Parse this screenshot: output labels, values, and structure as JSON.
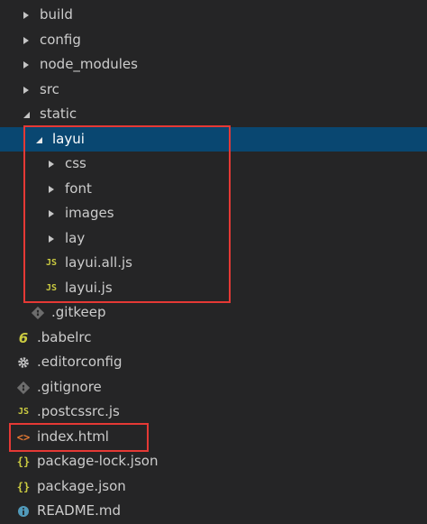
{
  "explorer": {
    "items": [
      {
        "label": "build"
      },
      {
        "label": "config"
      },
      {
        "label": "node_modules"
      },
      {
        "label": "src"
      },
      {
        "label": "static"
      },
      {
        "label": "layui"
      },
      {
        "label": "css"
      },
      {
        "label": "font"
      },
      {
        "label": "images"
      },
      {
        "label": "lay"
      },
      {
        "label": "layui.all.js"
      },
      {
        "label": "layui.js"
      },
      {
        "label": ".gitkeep"
      },
      {
        "label": ".babelrc"
      },
      {
        "label": ".editorconfig"
      },
      {
        "label": ".gitignore"
      },
      {
        "label": ".postcssrc.js"
      },
      {
        "label": "index.html"
      },
      {
        "label": "package-lock.json"
      },
      {
        "label": "package.json"
      },
      {
        "label": "README.md"
      }
    ],
    "icons": {
      "js": "JS",
      "json": "{}",
      "html": "<>",
      "babel": "6"
    }
  },
  "colors": {
    "background": "#252526",
    "selected": "#094771",
    "highlight": "#e53935",
    "text": "#cccccc",
    "js_icon": "#cbcb41",
    "html_icon": "#e37933"
  }
}
